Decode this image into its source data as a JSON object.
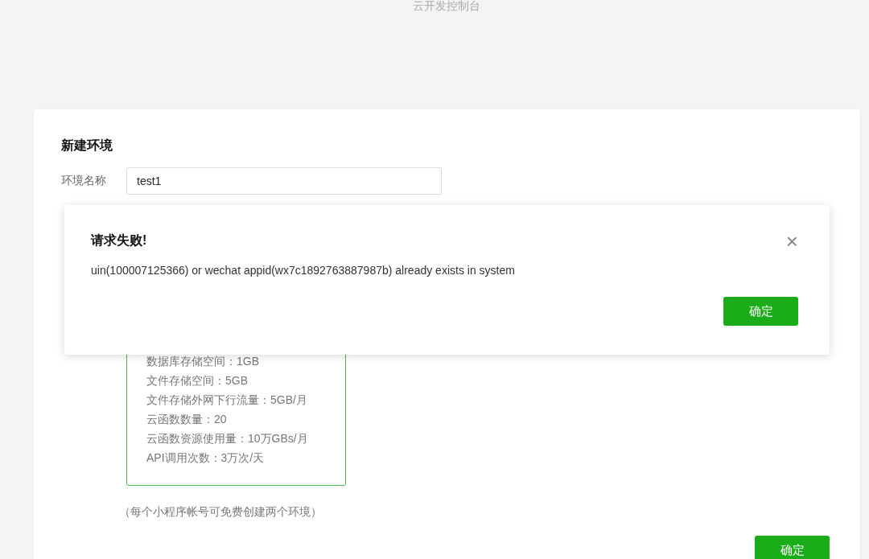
{
  "page_title": "云开发控制台",
  "form": {
    "title": "新建环境",
    "name_label": "环境名称",
    "name_value": "test1",
    "quota_lines": [
      "数据库存储空间：1GB",
      "文件存储空间：5GB",
      "文件存储外网下行流量：5GB/月",
      "云函数数量：20",
      "云函数资源使用量：10万GBs/月",
      "API调用次数：3万次/天"
    ],
    "note": "（每个小程序帐号可免费创建两个环境）",
    "submit": "确定"
  },
  "dialog": {
    "title": "请求失败!",
    "message": "uin(100007125366) or wechat appid(wx7c1892763887987b) already exists in system",
    "close": "×",
    "confirm": "确定"
  }
}
